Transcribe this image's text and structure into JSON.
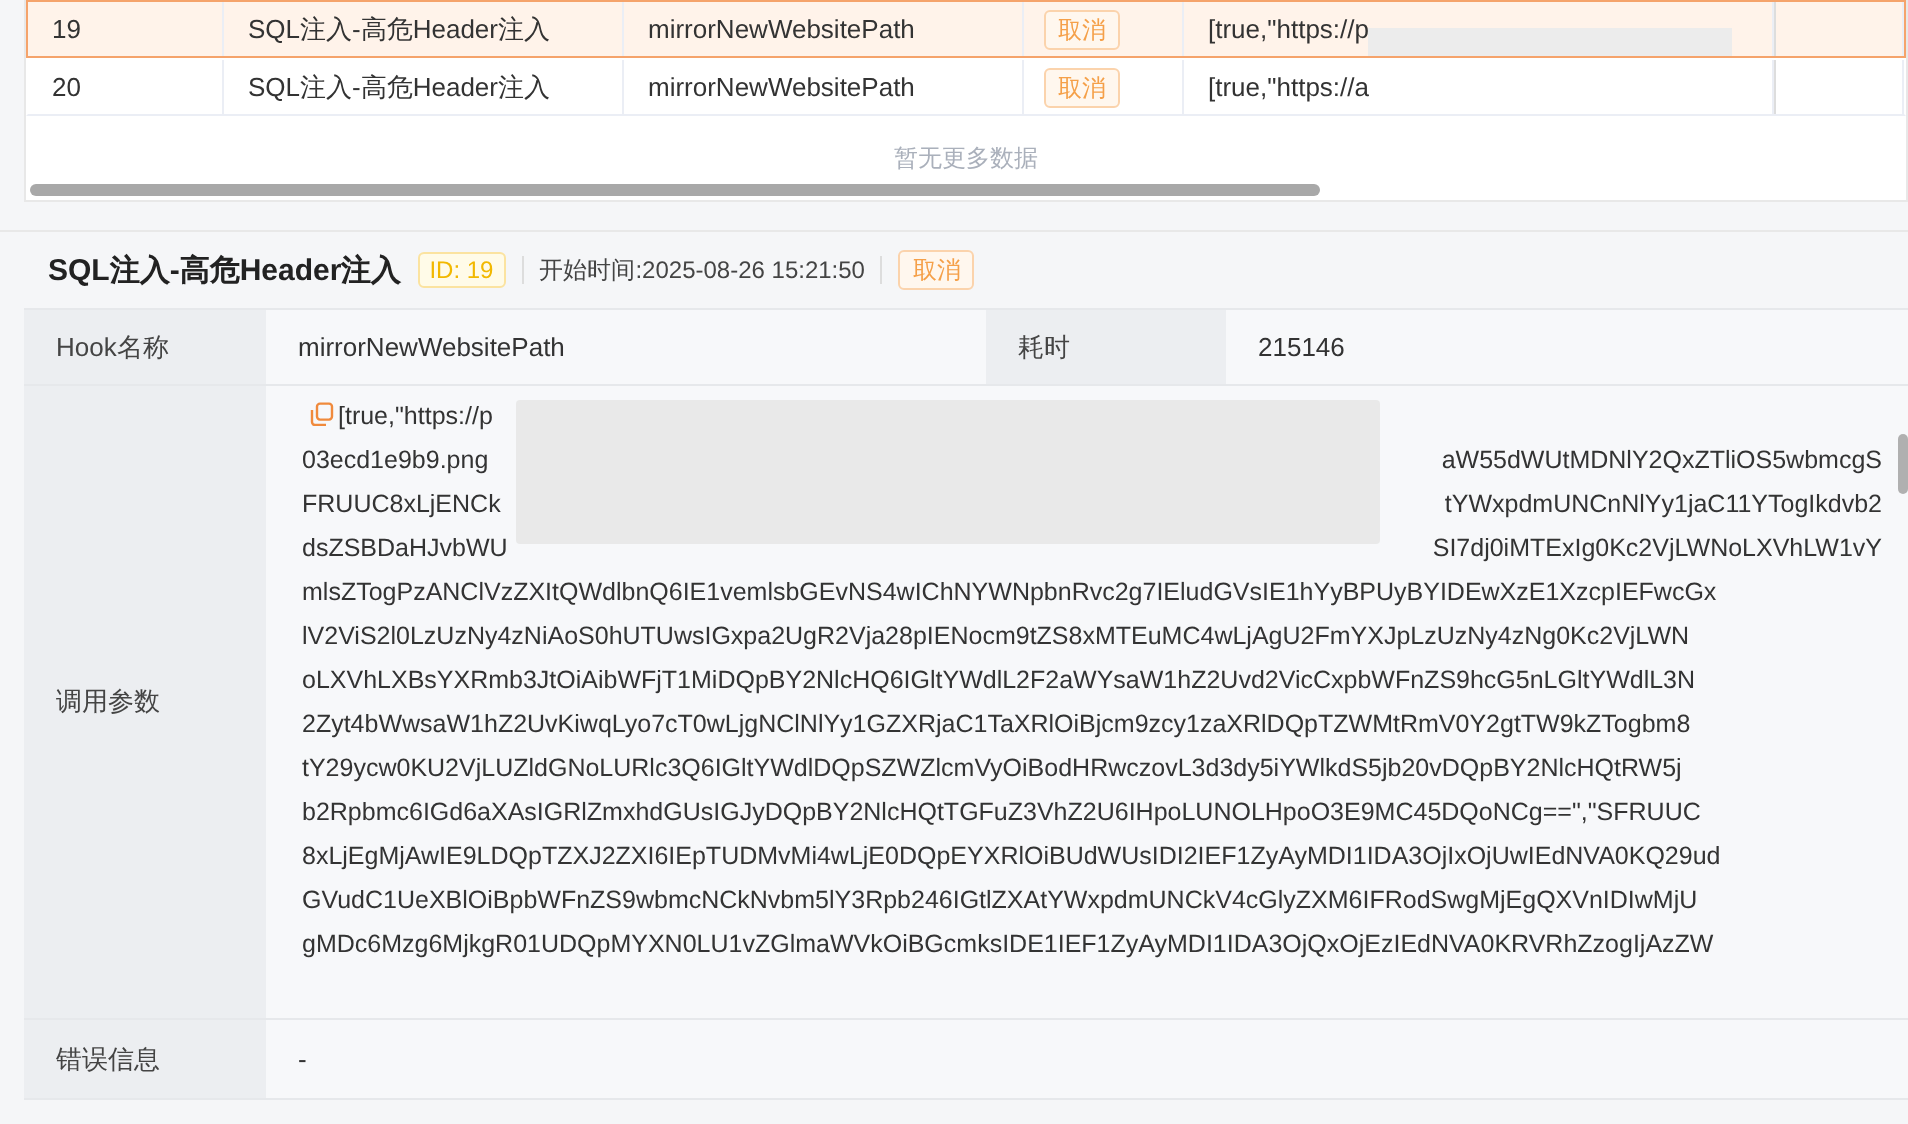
{
  "table": {
    "rows": [
      {
        "no": "19",
        "name": "SQL注入-高危Header注入",
        "hook": "mirrorNewWebsitePath",
        "status": "取消",
        "params": "[true,\"https://p",
        "selected": true
      },
      {
        "no": "20",
        "name": "SQL注入-高危Header注入",
        "hook": "mirrorNewWebsitePath",
        "status": "取消",
        "params": "[true,\"https://a",
        "selected": false
      }
    ],
    "footer": "暂无更多数据"
  },
  "detail": {
    "title": "SQL注入-高危Header注入",
    "id_tag": "ID: 19",
    "start_time": "开始时间:2025-08-26 15:21:50",
    "status": "取消",
    "hook_label": "Hook名称",
    "hook_value": "mirrorNewWebsitePath",
    "duration_label": "耗时",
    "duration_value": "215146",
    "params_label": "调用参数",
    "params_lines": [
      {
        "left": "[true,\"https://p"
      },
      {
        "left": "03ecd1e9b9.png",
        "right": "aW55dWUtMDNlY2QxZTliOS5wbmcgS"
      },
      {
        "left": "FRUUC8xLjENCk",
        "right": "tYWxpdmUNCnNlYy1jaC11YTogIkdvb2"
      },
      {
        "left": "dsZSBDaHJvbWU",
        "right": "SI7dj0iMTExIg0Kc2VjLWNoLXVhLW1vY"
      },
      {
        "left": "mlsZTogPzANClVzZXItQWdlbnQ6IE1vemlsbGEvNS4wIChNYWNpbnRvc2g7IEludGVsIE1hYyBPUyBYIDEwXzE1XzcpIEFwcGx"
      },
      {
        "left": "lV2ViS2l0LzUzNy4zNiAoS0hUTUwsIGxpa2UgR2Vja28pIENocm9tZS8xMTEuMC4wLjAgU2FmYXJpLzUzNy4zNg0Kc2VjLWN"
      },
      {
        "left": "oLXVhLXBsYXRmb3JtOiAibWFjT1MiDQpBY2NlcHQ6IGltYWdlL2F2aWYsaW1hZ2Uvd2VicCxpbWFnZS9hcG5nLGltYWdlL3N"
      },
      {
        "left": "2Zyt4bWwsaW1hZ2UvKiwqLyo7cT0wLjgNClNlYy1GZXRjaC1TaXRlOiBjcm9zcy1zaXRlDQpTZWMtRmV0Y2gtTW9kZTogbm8"
      },
      {
        "left": "tY29ycw0KU2VjLUZldGNoLURlc3Q6IGltYWdlDQpSZWZlcmVyOiBodHRwczovL3d3dy5iYWlkdS5jb20vDQpBY2NlcHQtRW5j"
      },
      {
        "left": "b2Rpbmc6IGd6aXAsIGRlZmxhdGUsIGJyDQpBY2NlcHQtTGFuZ3VhZ2U6IHpoLUNOLHpoO3E9MC45DQoNCg==\",\"SFRUUC"
      },
      {
        "left": "8xLjEgMjAwIE9LDQpTZXJ2ZXI6IEpTUDMvMi4wLjE0DQpEYXRlOiBUdWUsIDI2IEF1ZyAyMDI1IDA3OjIxOjUwIEdNVA0KQ29ud"
      },
      {
        "left": "GVudC1UeXBlOiBpbWFnZS9wbmcNCkNvbm5lY3Rpb246IGtlZXAtYWxpdmUNCkV4cGlyZXM6IFRodSwgMjEgQXVnIDIwMjU"
      },
      {
        "left": "gMDc6Mzg6MjkgR01UDQpMYXN0LU1vZGlmaWVkOiBGcmksIDE1IEF1ZyAyMDI1IDA3OjQxOjEzIEdNVA0KRVRhZzogIjAzZW"
      }
    ],
    "error_label": "错误信息",
    "error_value": "-"
  }
}
